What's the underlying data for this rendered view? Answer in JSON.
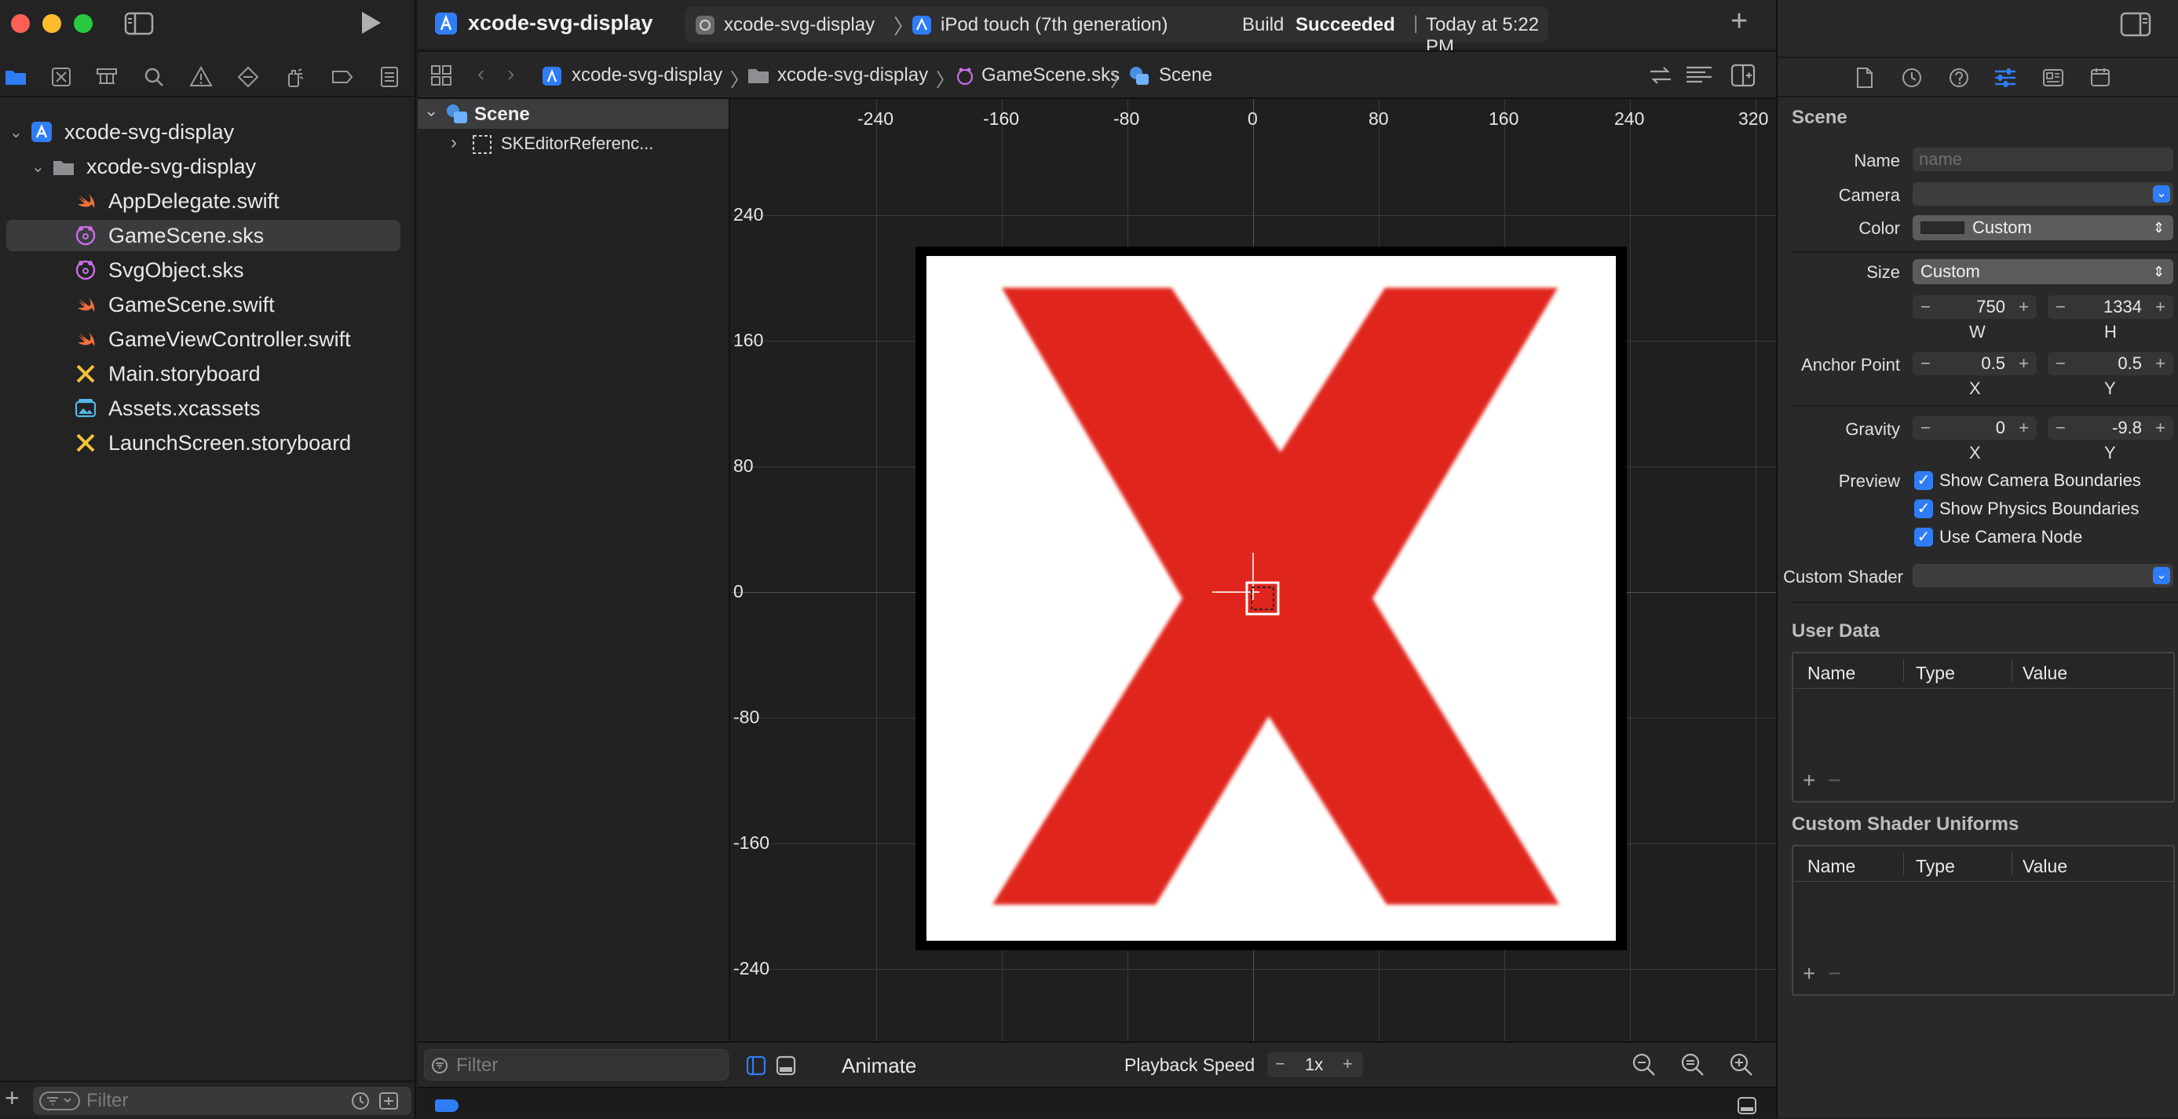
{
  "window": {
    "project_title": "xcode-svg-display",
    "scheme": "xcode-svg-display",
    "destination": "iPod touch (7th generation)",
    "status_prefix": "Build",
    "status_strong": "Succeeded",
    "status_time": "Today at 5:22 PM"
  },
  "navigator": {
    "items": [
      {
        "label": "xcode-svg-display",
        "kind": "project"
      },
      {
        "label": "xcode-svg-display",
        "kind": "folder"
      },
      {
        "label": "AppDelegate.swift",
        "kind": "swift"
      },
      {
        "label": "GameScene.sks",
        "kind": "sks"
      },
      {
        "label": "SvgObject.sks",
        "kind": "sks"
      },
      {
        "label": "GameScene.swift",
        "kind": "swift"
      },
      {
        "label": "GameViewController.swift",
        "kind": "swift"
      },
      {
        "label": "Main.storyboard",
        "kind": "storyboard"
      },
      {
        "label": "Assets.xcassets",
        "kind": "assets"
      },
      {
        "label": "LaunchScreen.storyboard",
        "kind": "storyboard"
      }
    ],
    "filter_placeholder": "Filter"
  },
  "jumpbar": {
    "crumbs": [
      "xcode-svg-display",
      "xcode-svg-display",
      "GameScene.sks",
      "Scene"
    ]
  },
  "outline": {
    "root": "Scene",
    "child": "SKEditorReferenc...",
    "filter_placeholder": "Filter"
  },
  "canvas": {
    "x_ticks": [
      "-240",
      "-160",
      "-80",
      "0",
      "80",
      "160",
      "240",
      "320"
    ],
    "y_ticks": [
      "240",
      "160",
      "80",
      "0",
      "-80",
      "-160",
      "-240"
    ],
    "sprite_colors": {
      "background": "#ffffff",
      "x_mark": "#e0251b",
      "border": "#000000"
    }
  },
  "scene_toolbar": {
    "animate": "Animate",
    "playback_label": "Playback Speed",
    "playback_value": "1x",
    "minus": "−",
    "plus": "+"
  },
  "inspector": {
    "section_title": "Scene",
    "name_label": "Name",
    "name_placeholder": "name",
    "camera_label": "Camera",
    "color_label": "Color",
    "color_value": "Custom",
    "size_label": "Size",
    "size_value": "Custom",
    "width": "750",
    "height": "1334",
    "w_label": "W",
    "h_label": "H",
    "anchor_label": "Anchor Point",
    "anchor_x": "0.5",
    "anchor_y": "0.5",
    "x_label": "X",
    "y_label": "Y",
    "gravity_label": "Gravity",
    "gravity_x": "0",
    "gravity_y": "-9.8",
    "preview_label": "Preview",
    "preview_options": [
      "Show Camera Boundaries",
      "Show Physics Boundaries",
      "Use Camera Node"
    ],
    "custom_shader_label": "Custom Shader",
    "user_data_title": "User Data",
    "uniforms_title": "Custom Shader Uniforms",
    "table_headers": [
      "Name",
      "Type",
      "Value"
    ]
  }
}
